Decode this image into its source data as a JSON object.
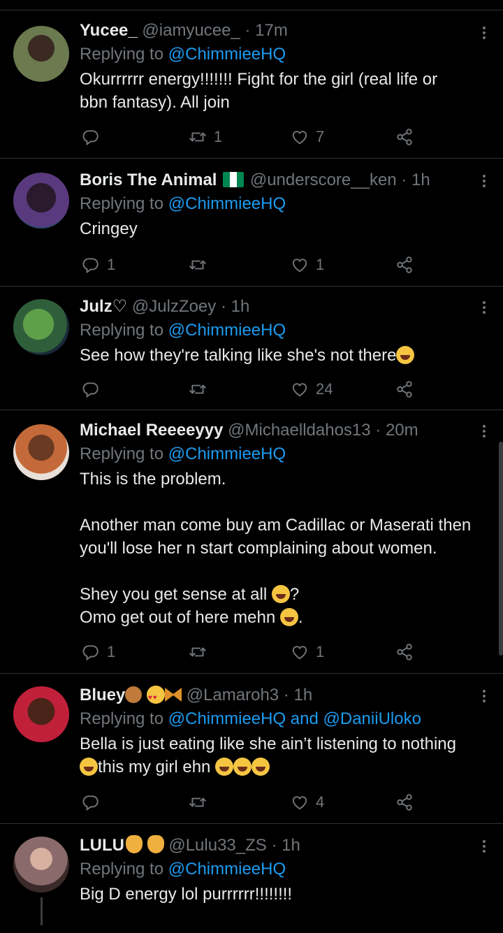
{
  "tweets": [
    {
      "name": "Yucee_",
      "handle": "@iamyucee_",
      "time": "· 17m",
      "replying_prefix": "Replying to",
      "mentions": "@ChimmieeHQ",
      "text": "Okurrrrrr energy!!!!!!! Fight for the girl (real life or\nbbn fantasy). All join",
      "replies": "",
      "retweets": "1",
      "likes": "7",
      "avatar_color": "#6b7a4f"
    },
    {
      "name": "Boris The Animal",
      "handle": "@underscore__ken",
      "time": "· 1h",
      "replying_prefix": "Replying to",
      "mentions": "@ChimmieeHQ",
      "text": "Cringey",
      "replies": "1",
      "retweets": "",
      "likes": "1",
      "avatar_color": "#4a2a5e"
    },
    {
      "name": "Julz♡",
      "handle": "@JulzZoey",
      "time": "· 1h",
      "replying_prefix": "Replying to",
      "mentions": "@ChimmieeHQ",
      "text": "See how they're talking like she's not there",
      "replies": "",
      "retweets": "",
      "likes": "24",
      "avatar_color": "#2f5f3a"
    },
    {
      "name": "Michael Reeeeyyy",
      "handle": "@Michaelldahos13",
      "time": "· 20m",
      "replying_prefix": "Replying to",
      "mentions": "@ChimmieeHQ",
      "text": "This is the problem.\n\nAnother man come buy am Cadillac or Maserati then\nyou'll lose her n start complaining about women.\n\nShey you get sense at all",
      "text_end_1": "?",
      "text_2": "Omo get out of here mehn",
      "text_end_2": ".",
      "replies": "1",
      "retweets": "",
      "likes": "1",
      "avatar_color": "#b4623a"
    },
    {
      "name": "Bluey",
      "handle": "@Lamaroh3",
      "time": "· 1h",
      "replying_prefix": "Replying to",
      "mentions": "@ChimmieeHQ and @DaniiUloko",
      "text": "Bella is just eating like she ain’t listening to nothing",
      "text_2": "this my girl ehn",
      "replies": "",
      "retweets": "",
      "likes": "4",
      "avatar_color": "#c0203a"
    },
    {
      "name": "LULU",
      "handle": "@Lulu33_ZS",
      "time": "· 1h",
      "replying_prefix": "Replying to",
      "mentions": "@ChimmieeHQ",
      "text": "Big D energy lol purrrrrr!!!!!!!!",
      "avatar_color": "#8a6a6a"
    }
  ],
  "icons": {
    "reply": "reply-icon",
    "retweet": "retweet-icon",
    "like": "heart-icon",
    "share": "share-icon",
    "more": "more-options-icon"
  },
  "colors": {
    "background": "#000000",
    "text": "#e7e9ea",
    "secondary": "#71767b",
    "link": "#1d9bf0",
    "divider": "#2f3336"
  }
}
